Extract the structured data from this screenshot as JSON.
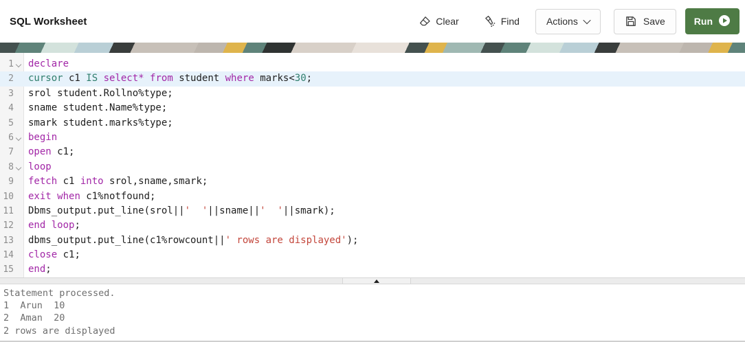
{
  "header": {
    "title": "SQL Worksheet"
  },
  "toolbar": {
    "clear_label": "Clear",
    "find_label": "Find",
    "actions_label": "Actions",
    "save_label": "Save",
    "run_label": "Run"
  },
  "icons": {
    "clear": "eraser-icon",
    "find": "flashlight-icon",
    "actions": "chevron-down-icon",
    "save": "floppy-disk-icon",
    "run": "play-circle-icon",
    "splitter": "collapse-up-icon"
  },
  "colors": {
    "run_button_green": "#4e7b45",
    "keyword_purple": "#a227a7",
    "keyword_teal": "#2f7e6d",
    "number_teal": "#2f7e6d",
    "string_red": "#c3463b",
    "current_line_highlight": "#e7f2fb"
  },
  "editor": {
    "current_line": 2,
    "foldable_lines": [
      1,
      6,
      8
    ],
    "lines": [
      {
        "n": 1,
        "tokens": [
          {
            "t": "declare",
            "c": "kw"
          }
        ]
      },
      {
        "n": 2,
        "tokens": [
          {
            "t": "cursor",
            "c": "kw2"
          },
          {
            "t": " c1 ",
            "c": "pl"
          },
          {
            "t": "IS",
            "c": "kw2"
          },
          {
            "t": " ",
            "c": "pl"
          },
          {
            "t": "select*",
            "c": "kw"
          },
          {
            "t": " ",
            "c": "pl"
          },
          {
            "t": "from",
            "c": "kw"
          },
          {
            "t": " student ",
            "c": "pl"
          },
          {
            "t": "where",
            "c": "kw"
          },
          {
            "t": " marks<",
            "c": "pl"
          },
          {
            "t": "30",
            "c": "num"
          },
          {
            "t": ";",
            "c": "pl"
          }
        ]
      },
      {
        "n": 3,
        "tokens": [
          {
            "t": "srol student.Rollno%type;",
            "c": "pl"
          }
        ]
      },
      {
        "n": 4,
        "tokens": [
          {
            "t": "sname student.Name%type;",
            "c": "pl"
          }
        ]
      },
      {
        "n": 5,
        "tokens": [
          {
            "t": "smark student.marks%type;",
            "c": "pl"
          }
        ]
      },
      {
        "n": 6,
        "tokens": [
          {
            "t": "begin",
            "c": "kw"
          }
        ]
      },
      {
        "n": 7,
        "tokens": [
          {
            "t": "open",
            "c": "kw"
          },
          {
            "t": " c1;",
            "c": "pl"
          }
        ]
      },
      {
        "n": 8,
        "tokens": [
          {
            "t": "loop",
            "c": "kw"
          }
        ]
      },
      {
        "n": 9,
        "tokens": [
          {
            "t": "fetch",
            "c": "kw"
          },
          {
            "t": " c1 ",
            "c": "pl"
          },
          {
            "t": "into",
            "c": "kw"
          },
          {
            "t": " srol,sname,smark;",
            "c": "pl"
          }
        ]
      },
      {
        "n": 10,
        "tokens": [
          {
            "t": "exit",
            "c": "kw"
          },
          {
            "t": " ",
            "c": "pl"
          },
          {
            "t": "when",
            "c": "kw"
          },
          {
            "t": " c1%notfound;",
            "c": "pl"
          }
        ]
      },
      {
        "n": 11,
        "tokens": [
          {
            "t": "Dbms_output.put_line(srol||",
            "c": "pl"
          },
          {
            "t": "'  '",
            "c": "str"
          },
          {
            "t": "||sname||",
            "c": "pl"
          },
          {
            "t": "'  '",
            "c": "str"
          },
          {
            "t": "||smark);",
            "c": "pl"
          }
        ]
      },
      {
        "n": 12,
        "tokens": [
          {
            "t": "end",
            "c": "kw"
          },
          {
            "t": " ",
            "c": "pl"
          },
          {
            "t": "loop",
            "c": "kw"
          },
          {
            "t": ";",
            "c": "pl"
          }
        ]
      },
      {
        "n": 13,
        "tokens": [
          {
            "t": "dbms_output.put_line(c1%rowcount||",
            "c": "pl"
          },
          {
            "t": "' rows are displayed'",
            "c": "str"
          },
          {
            "t": ");",
            "c": "pl"
          }
        ]
      },
      {
        "n": 14,
        "tokens": [
          {
            "t": "close",
            "c": "kw"
          },
          {
            "t": " c1;",
            "c": "pl"
          }
        ]
      },
      {
        "n": 15,
        "tokens": [
          {
            "t": "end",
            "c": "kw"
          },
          {
            "t": ";",
            "c": "pl"
          }
        ]
      }
    ]
  },
  "output": {
    "lines": [
      "Statement processed.",
      "1  Arun  10",
      "2  Aman  20",
      "2 rows are displayed"
    ]
  }
}
